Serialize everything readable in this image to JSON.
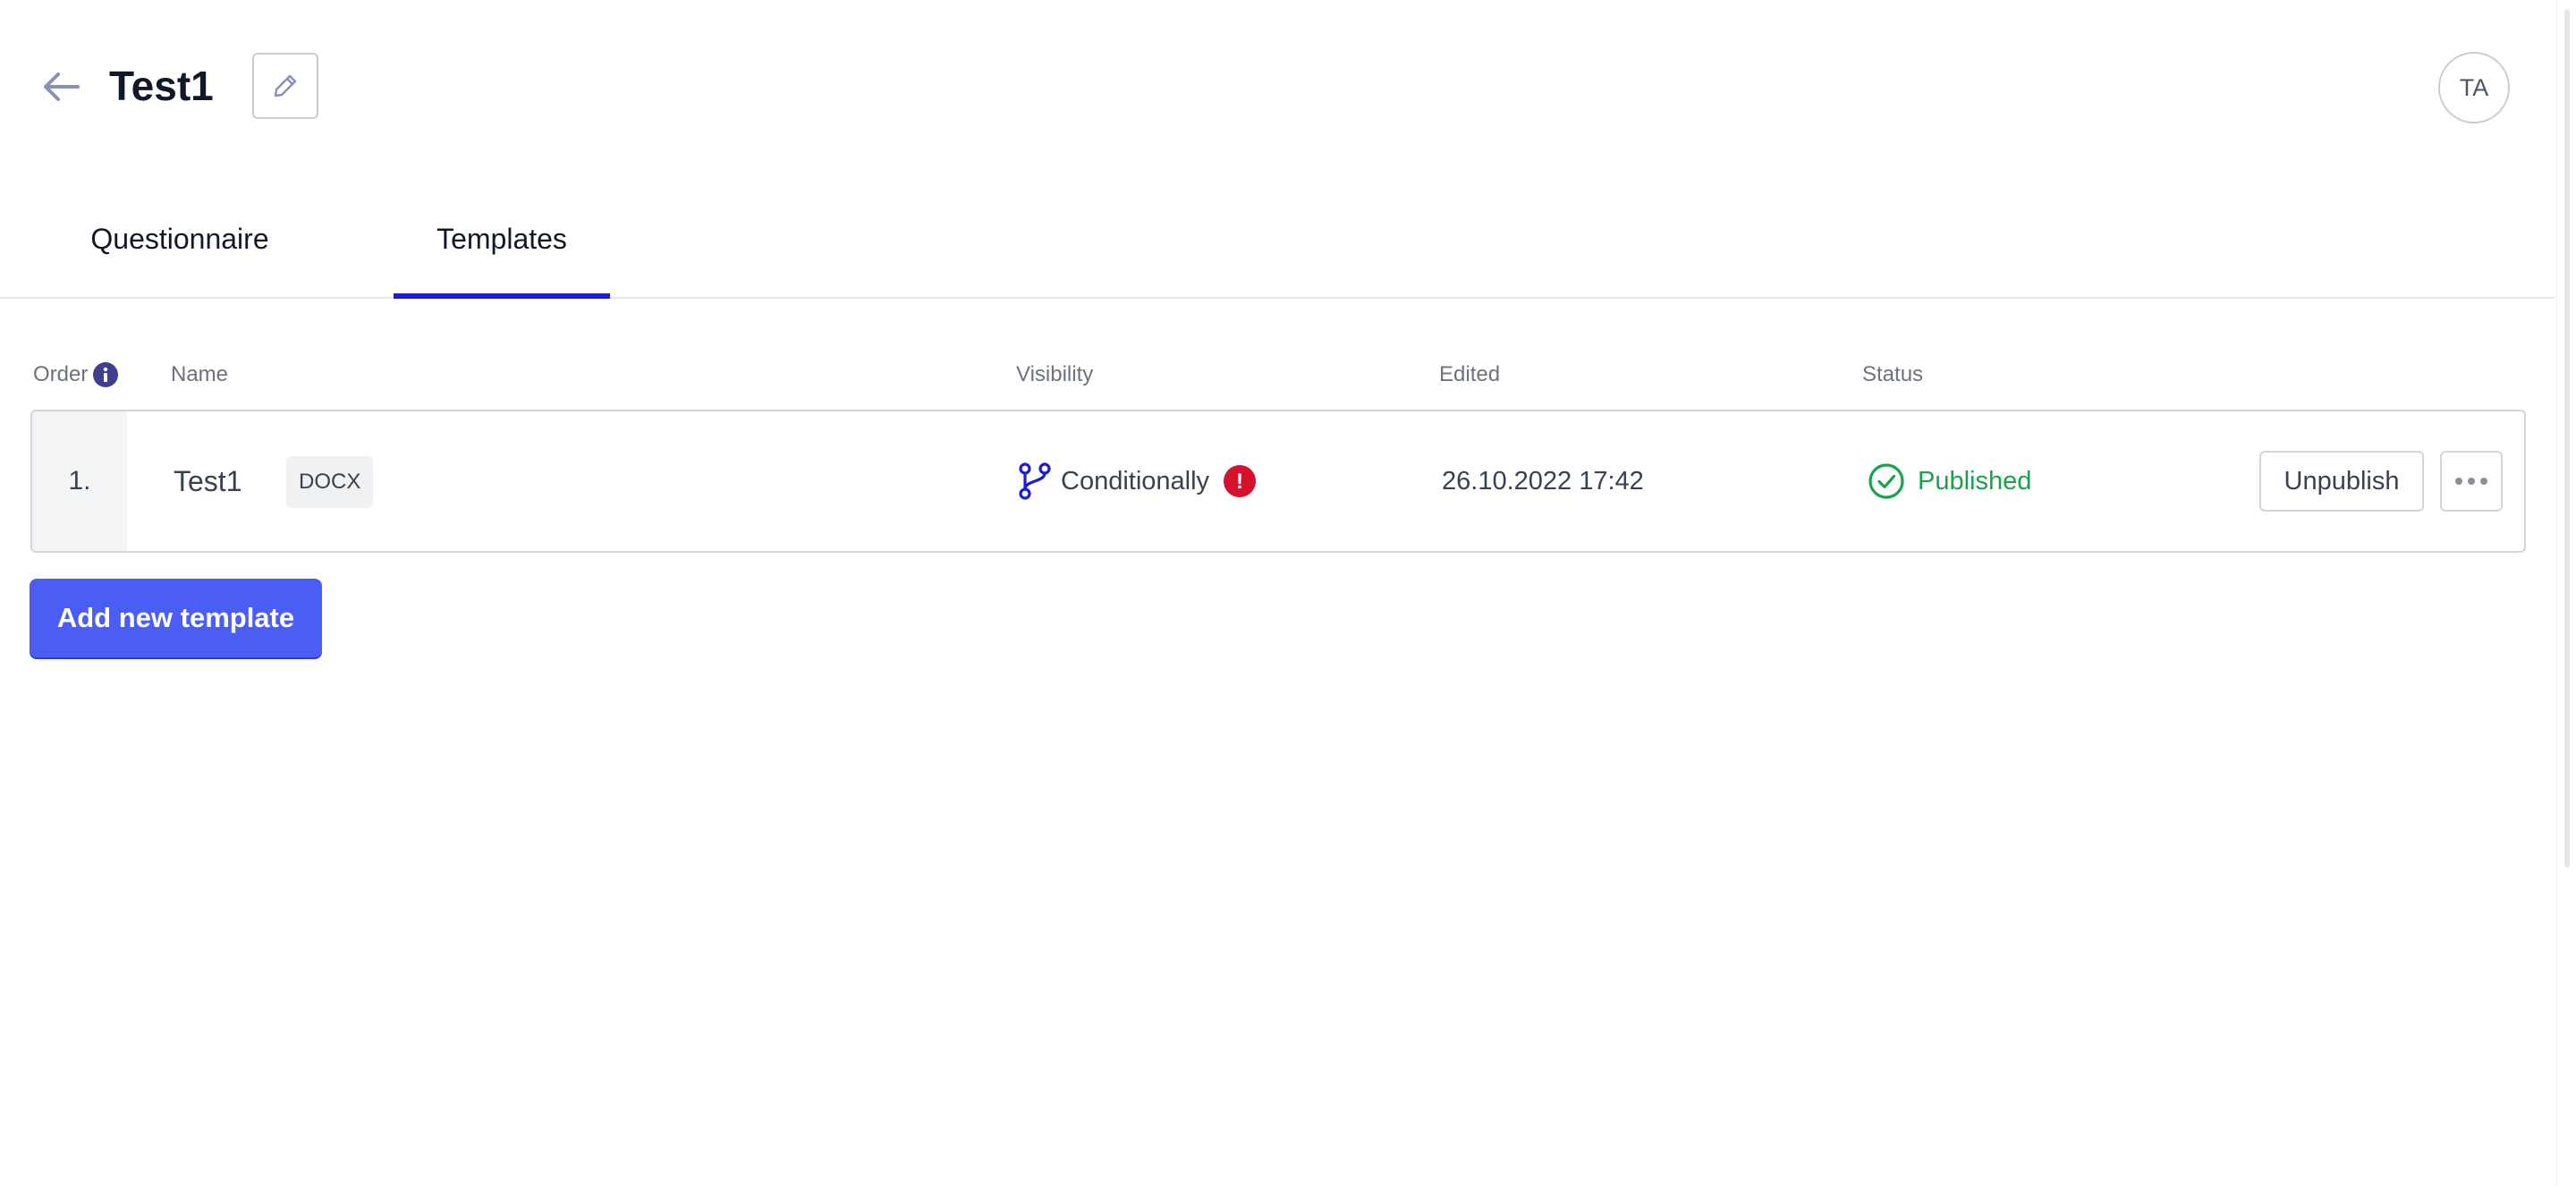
{
  "header": {
    "title": "Test1",
    "avatar_initials": "TA"
  },
  "tabs": [
    {
      "label": "Questionnaire",
      "active": false
    },
    {
      "label": "Templates",
      "active": true
    }
  ],
  "table": {
    "columns": {
      "order": "Order",
      "name": "Name",
      "visibility": "Visibility",
      "edited": "Edited",
      "status": "Status"
    },
    "rows": [
      {
        "order": "1.",
        "name": "Test1",
        "file_type": "DOCX",
        "visibility": "Conditionally",
        "visibility_warning": "!",
        "edited": "26.10.2022 17:42",
        "status": "Published",
        "action_label": "Unpublish"
      }
    ]
  },
  "add_button_label": "Add new template",
  "colors": {
    "accent": "#1d1dd6",
    "primary_button": "#4a5ef5",
    "published": "#16a34a",
    "warning": "#d6112d",
    "info_icon": "#3f3f8f"
  },
  "icons": {
    "back": "arrow-left-icon",
    "edit": "pencil-icon",
    "info": "info-icon",
    "visibility": "branch-icon",
    "warning": "exclamation-icon",
    "status": "check-circle-icon",
    "more": "more-dots-icon"
  }
}
